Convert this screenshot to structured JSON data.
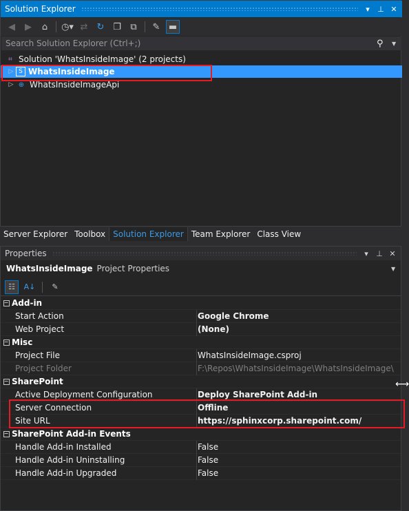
{
  "solution_explorer": {
    "title": "Solution Explorer",
    "search_placeholder": "Search Solution Explorer (Ctrl+;)",
    "tree": [
      {
        "label": "Solution 'WhatsInsideImage' (2 projects)",
        "icon": "solution-icon"
      },
      {
        "label": "WhatsInsideImage",
        "icon": "sharepoint-project-icon",
        "selected": true
      },
      {
        "label": "WhatsInsideImageApi",
        "icon": "web-project-icon"
      }
    ]
  },
  "tabs": [
    {
      "label": "Server Explorer"
    },
    {
      "label": "Toolbox"
    },
    {
      "label": "Solution Explorer",
      "active": true
    },
    {
      "label": "Team Explorer"
    },
    {
      "label": "Class View"
    }
  ],
  "properties": {
    "title": "Properties",
    "object_name": "WhatsInsideImage",
    "object_type": "Project Properties",
    "categories": [
      {
        "name": "Add-in",
        "rows": [
          {
            "name": "Start Action",
            "value": "Google Chrome",
            "bold": true
          },
          {
            "name": "Web Project",
            "value": "(None)",
            "bold": true
          }
        ]
      },
      {
        "name": "Misc",
        "rows": [
          {
            "name": "Project File",
            "value": "WhatsInsideImage.csproj"
          },
          {
            "name": "Project Folder",
            "value": "F:\\Repos\\WhatsInsideImage\\WhatsInsideImage\\",
            "readonly": true
          }
        ]
      },
      {
        "name": "SharePoint",
        "rows": [
          {
            "name": "Active Deployment Configuration",
            "value": "Deploy SharePoint Add-in",
            "bold": true
          },
          {
            "name": "Server Connection",
            "value": "Offline",
            "bold": true
          },
          {
            "name": "Site URL",
            "value": "https://sphinxcorp.sharepoint.com/",
            "bold": true
          }
        ]
      },
      {
        "name": "SharePoint Add-in Events",
        "rows": [
          {
            "name": "Handle Add-in Installed",
            "value": "False"
          },
          {
            "name": "Handle Add-in Uninstalling",
            "value": "False"
          },
          {
            "name": "Handle Add-in Upgraded",
            "value": "False"
          }
        ]
      }
    ]
  },
  "colors": {
    "accent": "#007acc",
    "selection": "#3399ff",
    "highlight": "#e51c23"
  }
}
